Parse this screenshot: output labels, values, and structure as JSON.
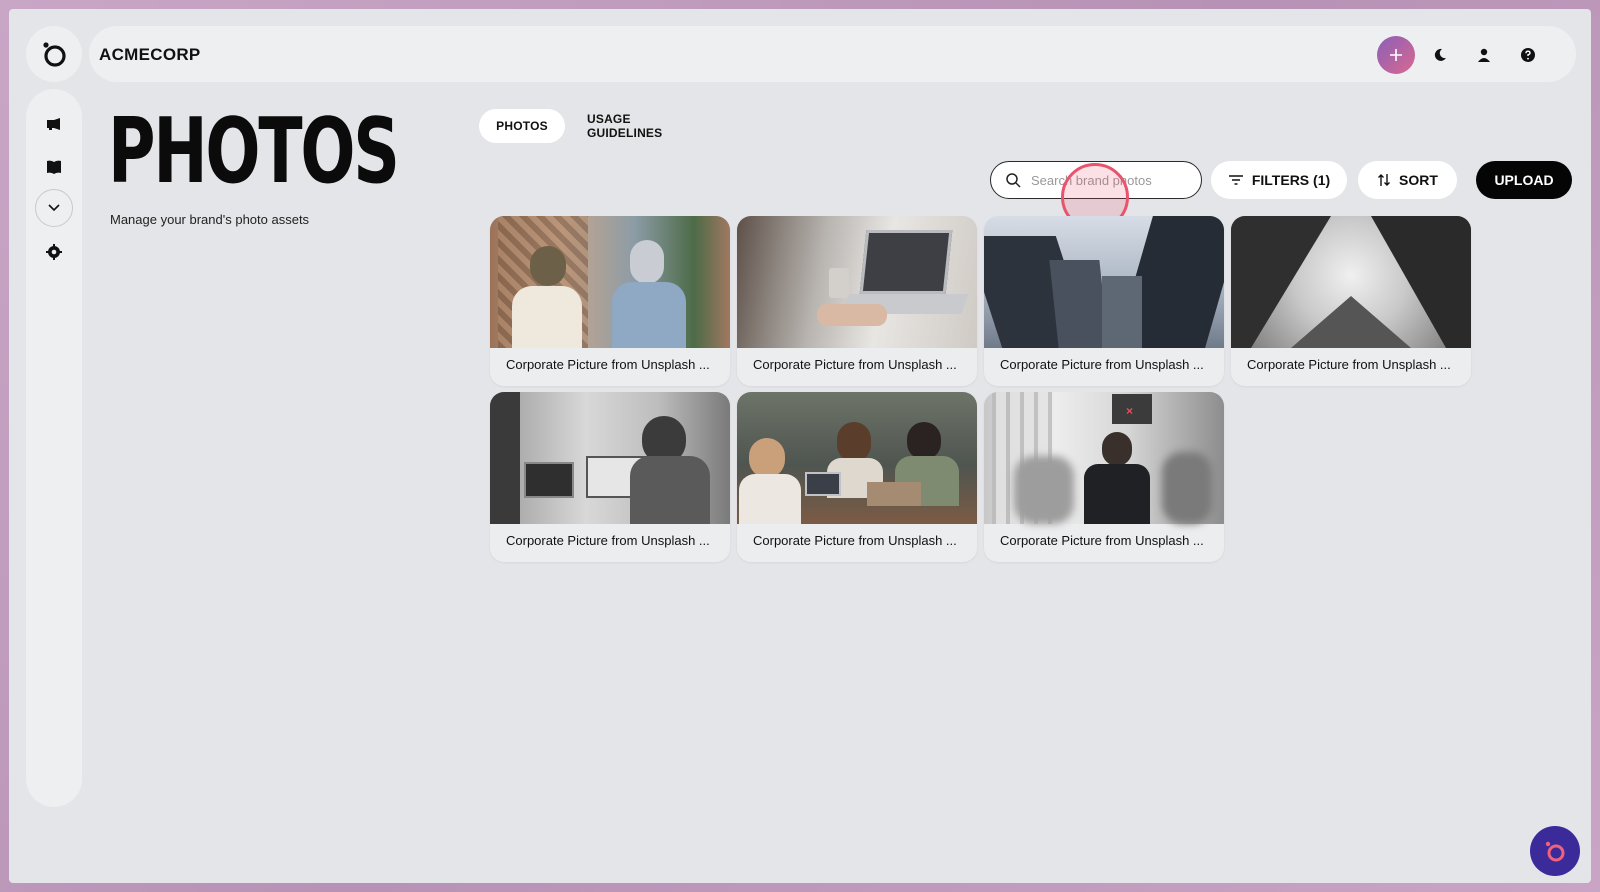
{
  "app": {
    "brand": "ACMECORP"
  },
  "page": {
    "title": "PHOTOS",
    "subtitle": "Manage your brand's photo assets"
  },
  "tabs": [
    {
      "label": "PHOTOS",
      "active": true
    },
    {
      "label": "USAGE GUIDELINES",
      "active": false
    }
  ],
  "search": {
    "placeholder": "Search brand photos",
    "value": ""
  },
  "toolbar": {
    "filters_label": "FILTERS (1)",
    "sort_label": "SORT",
    "upload_label": "UPLOAD"
  },
  "photos": [
    {
      "caption": "Corporate Picture from Unsplash ..."
    },
    {
      "caption": "Corporate Picture from Unsplash ..."
    },
    {
      "caption": "Corporate Picture from Unsplash ..."
    },
    {
      "caption": "Corporate Picture from Unsplash ..."
    },
    {
      "caption": "Corporate Picture from Unsplash ..."
    },
    {
      "caption": "Corporate Picture from Unsplash ..."
    },
    {
      "caption": "Corporate Picture from Unsplash ..."
    }
  ],
  "icons": {
    "logo": "logo-icon",
    "campaigns": "megaphone-icon",
    "guidelines": "book-icon",
    "expand": "chevron-down-icon",
    "settings": "gear-icon",
    "add": "plus-icon",
    "theme": "moon-icon",
    "profile": "user-icon",
    "help": "question-icon",
    "search": "search-icon",
    "filter": "filter-icon",
    "sort": "sort-icon",
    "assistant": "assistant-icon"
  },
  "colors": {
    "accent_gradient_start": "#8a5fb8",
    "accent_gradient_end": "#d9698f",
    "upload_bg": "#050505",
    "fab_bg": "#3b2a9a"
  }
}
